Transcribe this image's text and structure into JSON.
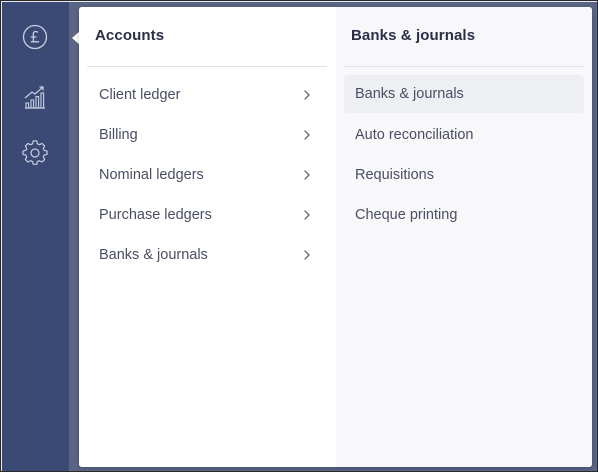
{
  "rail": {
    "items": [
      {
        "icon": "pound-icon",
        "active": true
      },
      {
        "icon": "chart-growth-icon",
        "active": false
      },
      {
        "icon": "gear-icon",
        "active": false
      }
    ]
  },
  "accounts": {
    "title": "Accounts",
    "items": [
      {
        "label": "Client ledger"
      },
      {
        "label": "Billing"
      },
      {
        "label": "Nominal ledgers"
      },
      {
        "label": "Purchase ledgers"
      },
      {
        "label": "Banks & journals"
      }
    ]
  },
  "submenu": {
    "title": "Banks & journals",
    "items": [
      {
        "label": "Banks & journals",
        "selected": true
      },
      {
        "label": "Auto reconciliation"
      },
      {
        "label": "Requisitions"
      },
      {
        "label": "Cheque printing"
      }
    ]
  },
  "colors": {
    "rail": "#3a4a75",
    "panel": "#ffffff",
    "submenu_bg": "#f8f8fb",
    "text": "#4a4e63",
    "title": "#2b2f45"
  }
}
